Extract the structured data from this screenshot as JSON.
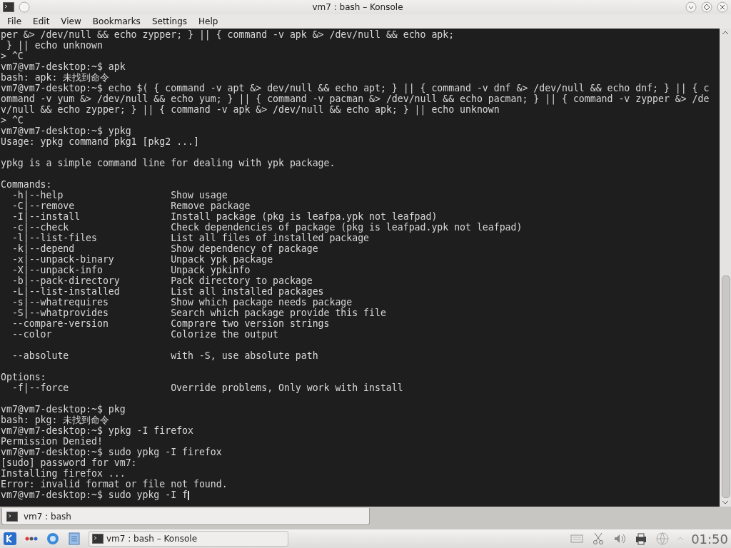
{
  "window": {
    "title": "vm7 : bash – Konsole"
  },
  "menu": [
    "File",
    "Edit",
    "View",
    "Bookmarks",
    "Settings",
    "Help"
  ],
  "terminal": {
    "cursor_visible": true,
    "lines": [
      {
        "kind": "text",
        "text": "per &> /dev/null && echo zypper; } || { command -v apk &> /dev/null && echo apk;"
      },
      {
        "kind": "text",
        "text": " } || echo unknown"
      },
      {
        "kind": "text",
        "text": "> ^C"
      },
      {
        "kind": "text",
        "text": "vm7@vm7-desktop:~$ apk"
      },
      {
        "kind": "text",
        "text": "bash: apk: 未找到命令"
      },
      {
        "kind": "text",
        "text": "vm7@vm7-desktop:~$ echo $( { command -v apt &> dev/null && echo apt; } || { command -v dnf &> /dev/null && echo dnf; } || { c"
      },
      {
        "kind": "text",
        "text": "ommand -v yum &> /dev/null && echo yum; } || { command -v pacman &> /dev/null && echo pacman; } || { command -v zypper &> /de"
      },
      {
        "kind": "text",
        "text": "v/null && echo zypper; } || { command -v apk &> /dev/null && echo apk; } || echo unknown"
      },
      {
        "kind": "text",
        "text": "> ^C"
      },
      {
        "kind": "text",
        "text": "vm7@vm7-desktop:~$ ypkg"
      },
      {
        "kind": "text",
        "text": "Usage: ypkg command pkg1 [pkg2 ...]"
      },
      {
        "kind": "blank"
      },
      {
        "kind": "text",
        "text": "ypkg is a simple command line for dealing with ypk package."
      },
      {
        "kind": "blank"
      },
      {
        "kind": "text",
        "text": "Commands:"
      },
      {
        "kind": "row",
        "option": "-h|--help",
        "description": "Show usage"
      },
      {
        "kind": "row",
        "option": "-C|--remove",
        "description": "Remove package"
      },
      {
        "kind": "row",
        "option": "-I|--install",
        "description": "Install package (pkg is leafpa.ypk not leafpad)"
      },
      {
        "kind": "row",
        "option": "-c|--check",
        "description": "Check dependencies of package (pkg is leafpad.ypk not leafpad)"
      },
      {
        "kind": "row",
        "option": "-l|--list-files",
        "description": "List all files of installed package"
      },
      {
        "kind": "row",
        "option": "-k|--depend",
        "description": "Show dependency of package"
      },
      {
        "kind": "row",
        "option": "-x|--unpack-binary",
        "description": "Unpack ypk package"
      },
      {
        "kind": "row",
        "option": "-X|--unpack-info",
        "description": "Unpack ypkinfo"
      },
      {
        "kind": "row",
        "option": "-b|--pack-directory",
        "description": "Pack directory to package"
      },
      {
        "kind": "row",
        "option": "-L|--list-installed",
        "description": "List all installed packages"
      },
      {
        "kind": "row",
        "option": "-s|--whatrequires",
        "description": "Show which package needs package"
      },
      {
        "kind": "row",
        "option": "-S|--whatprovides",
        "description": "Search which package provide this file"
      },
      {
        "kind": "row",
        "option": "--compare-version",
        "description": "Comprare two version strings"
      },
      {
        "kind": "row",
        "option": "--color",
        "description": "Colorize the output"
      },
      {
        "kind": "blank"
      },
      {
        "kind": "row",
        "option": "--absolute",
        "description": "with -S, use absolute path"
      },
      {
        "kind": "blank"
      },
      {
        "kind": "text",
        "text": "Options:"
      },
      {
        "kind": "row",
        "option": "-f|--force",
        "description": "Override problems, Only work with install"
      },
      {
        "kind": "blank"
      },
      {
        "kind": "text",
        "text": "vm7@vm7-desktop:~$ pkg"
      },
      {
        "kind": "text",
        "text": "bash: pkg: 未找到命令"
      },
      {
        "kind": "text",
        "text": "vm7@vm7-desktop:~$ ypkg -I firefox"
      },
      {
        "kind": "text",
        "text": "Permission Denied!"
      },
      {
        "kind": "text",
        "text": "vm7@vm7-desktop:~$ sudo ypkg -I firefox"
      },
      {
        "kind": "text",
        "text": "[sudo] password for vm7:"
      },
      {
        "kind": "text",
        "text": "Installing firefox ..."
      },
      {
        "kind": "text",
        "text": "Error: invalid format or file not found."
      },
      {
        "kind": "text",
        "text": "vm7@vm7-desktop:~$ sudo ypkg -I f"
      }
    ]
  },
  "session_tabs": [
    {
      "label": "vm7 : bash",
      "selected": true
    }
  ],
  "taskbar": {
    "tasks": [
      {
        "label": "vm7 : bash – Konsole",
        "selected": false
      }
    ],
    "clock": "01:50"
  }
}
